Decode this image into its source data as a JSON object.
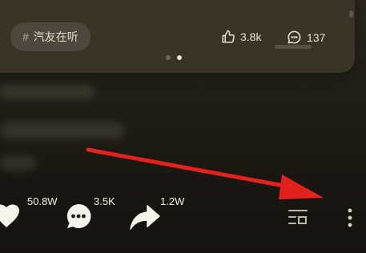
{
  "card": {
    "topic_hash": "#",
    "topic_label": "汽友在听",
    "likes": "3.8k",
    "comments": "137",
    "carousel_total": 2,
    "carousel_active_index": 1
  },
  "actions": {
    "like_count": "50.8W",
    "comment_count": "3.5K",
    "share_count": "1.2W"
  },
  "colors": {
    "annotation_arrow": "#e3221e",
    "text": "#f3efe6",
    "card_bg": "#3b3426"
  },
  "icons": {
    "like": "thumbs-up-icon",
    "comment": "comment-bubble-icon",
    "heart": "heart-icon",
    "chat": "chat-bubble-icon",
    "share": "share-arrow-icon",
    "playlist": "playlist-icon",
    "more": "more-vertical-icon"
  }
}
